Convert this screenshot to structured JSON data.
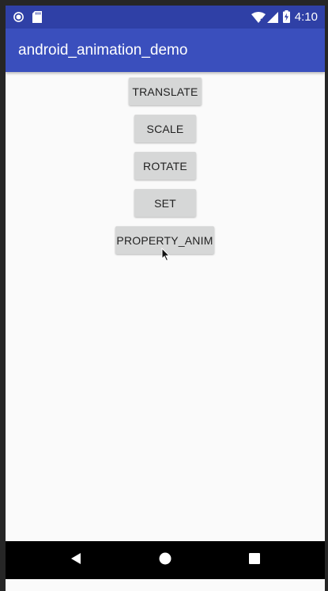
{
  "status_bar": {
    "time": "4:10",
    "left_icons": [
      "record-icon",
      "sd-card-icon"
    ],
    "right_icons": [
      "wifi-icon",
      "signal-icon",
      "battery-charging-icon"
    ]
  },
  "app_bar": {
    "title": "android_animation_demo"
  },
  "buttons": {
    "translate": "TRANSLATE",
    "scale": "SCALE",
    "rotate": "ROTATE",
    "set": "SET",
    "property_anim": "PROPERTY_ANIM"
  },
  "nav_bar": {
    "icons": [
      "back-icon",
      "home-icon",
      "recents-icon"
    ]
  },
  "colors": {
    "status_bar": "#2f40a6",
    "app_bar": "#3a4fbd",
    "button_bg": "#d6d7d7",
    "content_bg": "#fafafa"
  }
}
